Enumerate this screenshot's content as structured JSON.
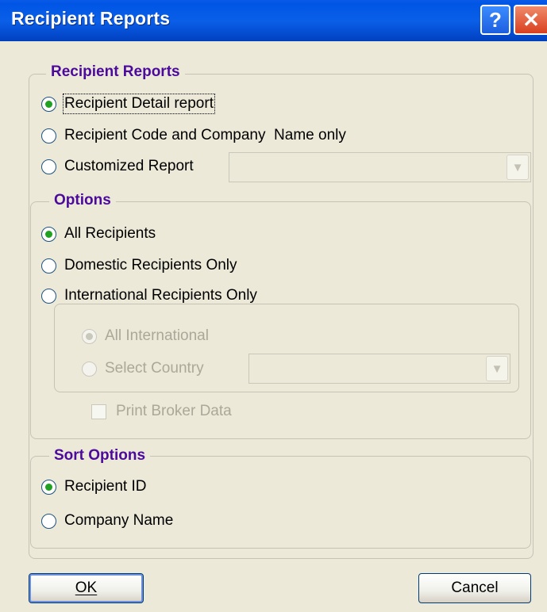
{
  "window": {
    "title": "Recipient Reports",
    "help_icon": "question-mark-icon",
    "close_icon": "close-x-icon"
  },
  "report_group": {
    "legend": "Recipient Reports",
    "options": [
      {
        "label": "Recipient Detail report",
        "selected": true
      },
      {
        "label": "Recipient Code and Company  Name only",
        "selected": false
      },
      {
        "label": "Customized Report",
        "selected": false
      }
    ],
    "custom_combo_value": ""
  },
  "options_group": {
    "legend": "Options",
    "options": [
      {
        "label": "All Recipients",
        "selected": true
      },
      {
        "label": "Domestic Recipients Only",
        "selected": false
      },
      {
        "label": "International Recipients Only",
        "selected": false
      }
    ],
    "international": {
      "options": [
        {
          "label": "All International",
          "selected": true,
          "enabled": false
        },
        {
          "label": "Select Country",
          "selected": false,
          "enabled": false
        }
      ],
      "country_combo_value": ""
    },
    "print_broker": {
      "label": "Print Broker Data",
      "checked": false,
      "enabled": false
    }
  },
  "sort_group": {
    "legend": "Sort Options",
    "options": [
      {
        "label": "Recipient ID",
        "selected": true
      },
      {
        "label": "Company Name",
        "selected": false
      }
    ]
  },
  "buttons": {
    "ok_label": "OK",
    "cancel_label": "Cancel"
  },
  "colors": {
    "title_bar": "#0055e5",
    "legend_text": "#4b0a9c",
    "dialog_bg": "#ece9d8",
    "radio_dot": "#21a121"
  }
}
